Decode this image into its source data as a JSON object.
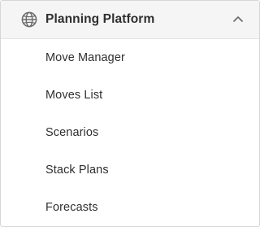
{
  "nav": {
    "header": {
      "label": "Planning Platform",
      "icon": "globe-icon",
      "toggle_icon": "chevron-up-icon",
      "expanded": true
    },
    "items": [
      {
        "label": "Move Manager"
      },
      {
        "label": "Moves List"
      },
      {
        "label": "Scenarios"
      },
      {
        "label": "Stack Plans"
      },
      {
        "label": "Forecasts"
      }
    ]
  },
  "colors": {
    "header_bg": "#f5f5f5",
    "text": "#2f2f2f",
    "icon": "#6b6b6b",
    "border": "#d6d6d6"
  }
}
